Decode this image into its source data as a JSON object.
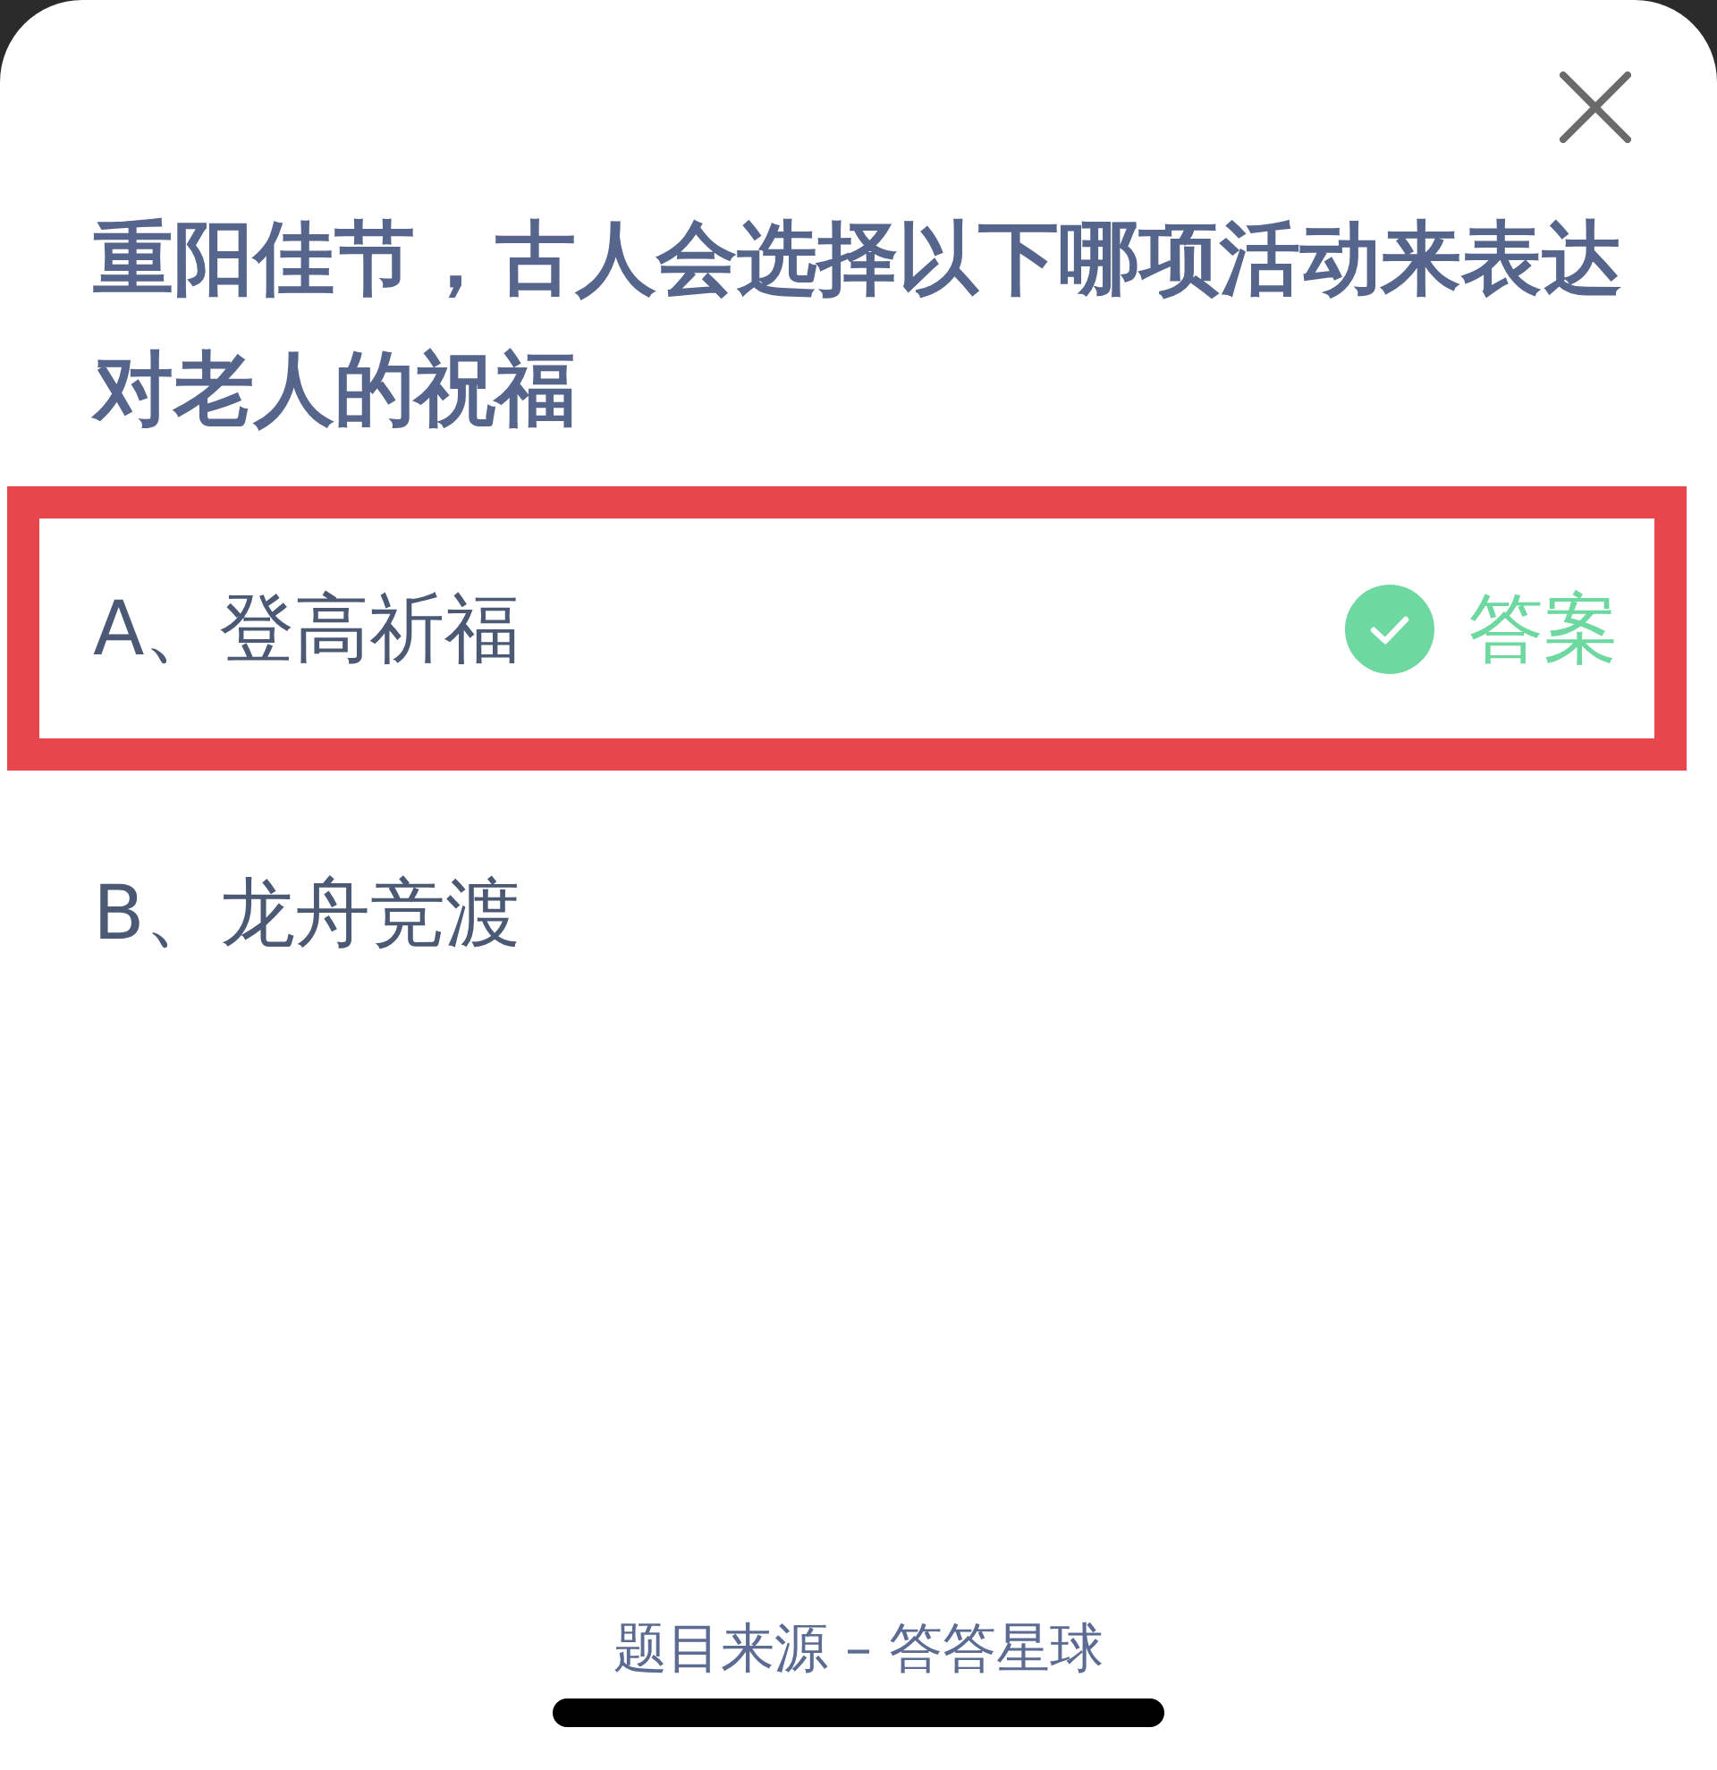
{
  "question": {
    "title": "重阳佳节，古人会选择以下哪项活动来表达对老人的祝福"
  },
  "options": [
    {
      "text": "A、登高祈福",
      "highlighted": true,
      "correct": true,
      "answer_label": "答案"
    },
    {
      "text": "B、龙舟竞渡",
      "highlighted": false,
      "correct": false
    }
  ],
  "footer": {
    "source": "题目来源 – 答答星球"
  }
}
